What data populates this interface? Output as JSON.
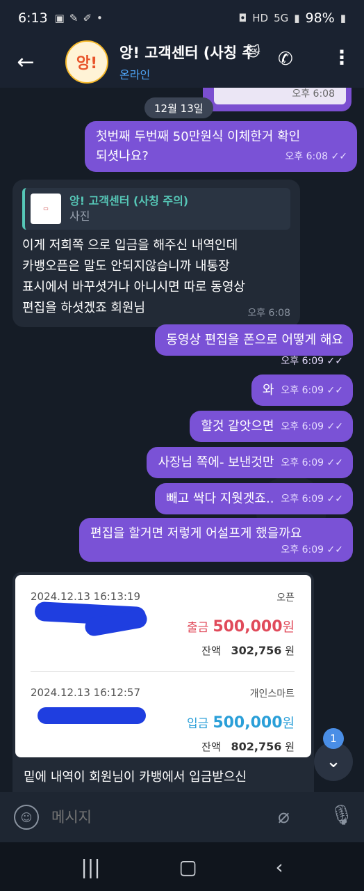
{
  "status_bar": {
    "time": "6:13",
    "battery": "98%",
    "network": "5G",
    "hd": "HD"
  },
  "header": {
    "avatar_text": "앙!",
    "title": "앙! 고객센터 (사칭 주의)",
    "status": "온라인"
  },
  "chat": {
    "prev_time": "오후 6:08",
    "date": "12월 13일",
    "messages": [
      {
        "text": "첫번째 두번째 50만원식 이체한거 확인 되셧나요?",
        "line1": "첫번째 두번째 50만원식 이체한거 확인",
        "line2": "되셧나요?",
        "time": "오후 6:08"
      },
      {
        "text": "동영상 편집을 폰으로 어떻게 해요",
        "time": "오후 6:09"
      },
      {
        "text": "와",
        "time": "오후 6:09"
      },
      {
        "text": "할것 같앗으면",
        "time": "오후 6:09"
      },
      {
        "text": "사장님 쪽에- 보낸것만",
        "time": "오후 6:09"
      },
      {
        "text": "빼고 싹다 지웟겟죠..",
        "time": "오후 6:09"
      },
      {
        "text": "편집을 할거면 저렇게 어설프게 했을까요",
        "time": "오후 6:09"
      }
    ],
    "incoming": {
      "quote_name": "앙! 고객센터 (사칭 주의)",
      "quote_sub": "사진",
      "lines": [
        "이게 저희쪽 으로 입금을 해주신 내역인데",
        "카뱅오픈은 말도 안되지않습니까 내통장",
        "표시에서 바꾸셧거나 아니시면 따로 동영상",
        "편집을 하셧겠죠 회원님"
      ],
      "time": "오후 6:08"
    },
    "receipt": {
      "tx1": {
        "date": "2024.12.13 16:13:19",
        "account": "오픈",
        "label": "출금",
        "amount": "500,000",
        "unit": "원",
        "balance_label": "잔액",
        "balance": "302,756",
        "balance_unit": "원"
      },
      "tx2": {
        "date": "2024.12.13 16:12:57",
        "account": "개인스마트",
        "label": "입금",
        "amount": "500,000",
        "unit": "원",
        "balance_label": "잔액",
        "balance": "802,756",
        "balance_unit": "원"
      }
    },
    "image_caption": "밑에 내역이 회원님이 카뱅에서 입금받으신"
  },
  "unread_count": "1",
  "input": {
    "placeholder": "메시지"
  },
  "colors": {
    "outgoing": "#7a52d6",
    "incoming": "#222a36",
    "accent_teal": "#56c7b7",
    "online_blue": "#4ea4f5",
    "withdraw_red": "#e04a5a",
    "deposit_blue": "#2a9fd8"
  }
}
